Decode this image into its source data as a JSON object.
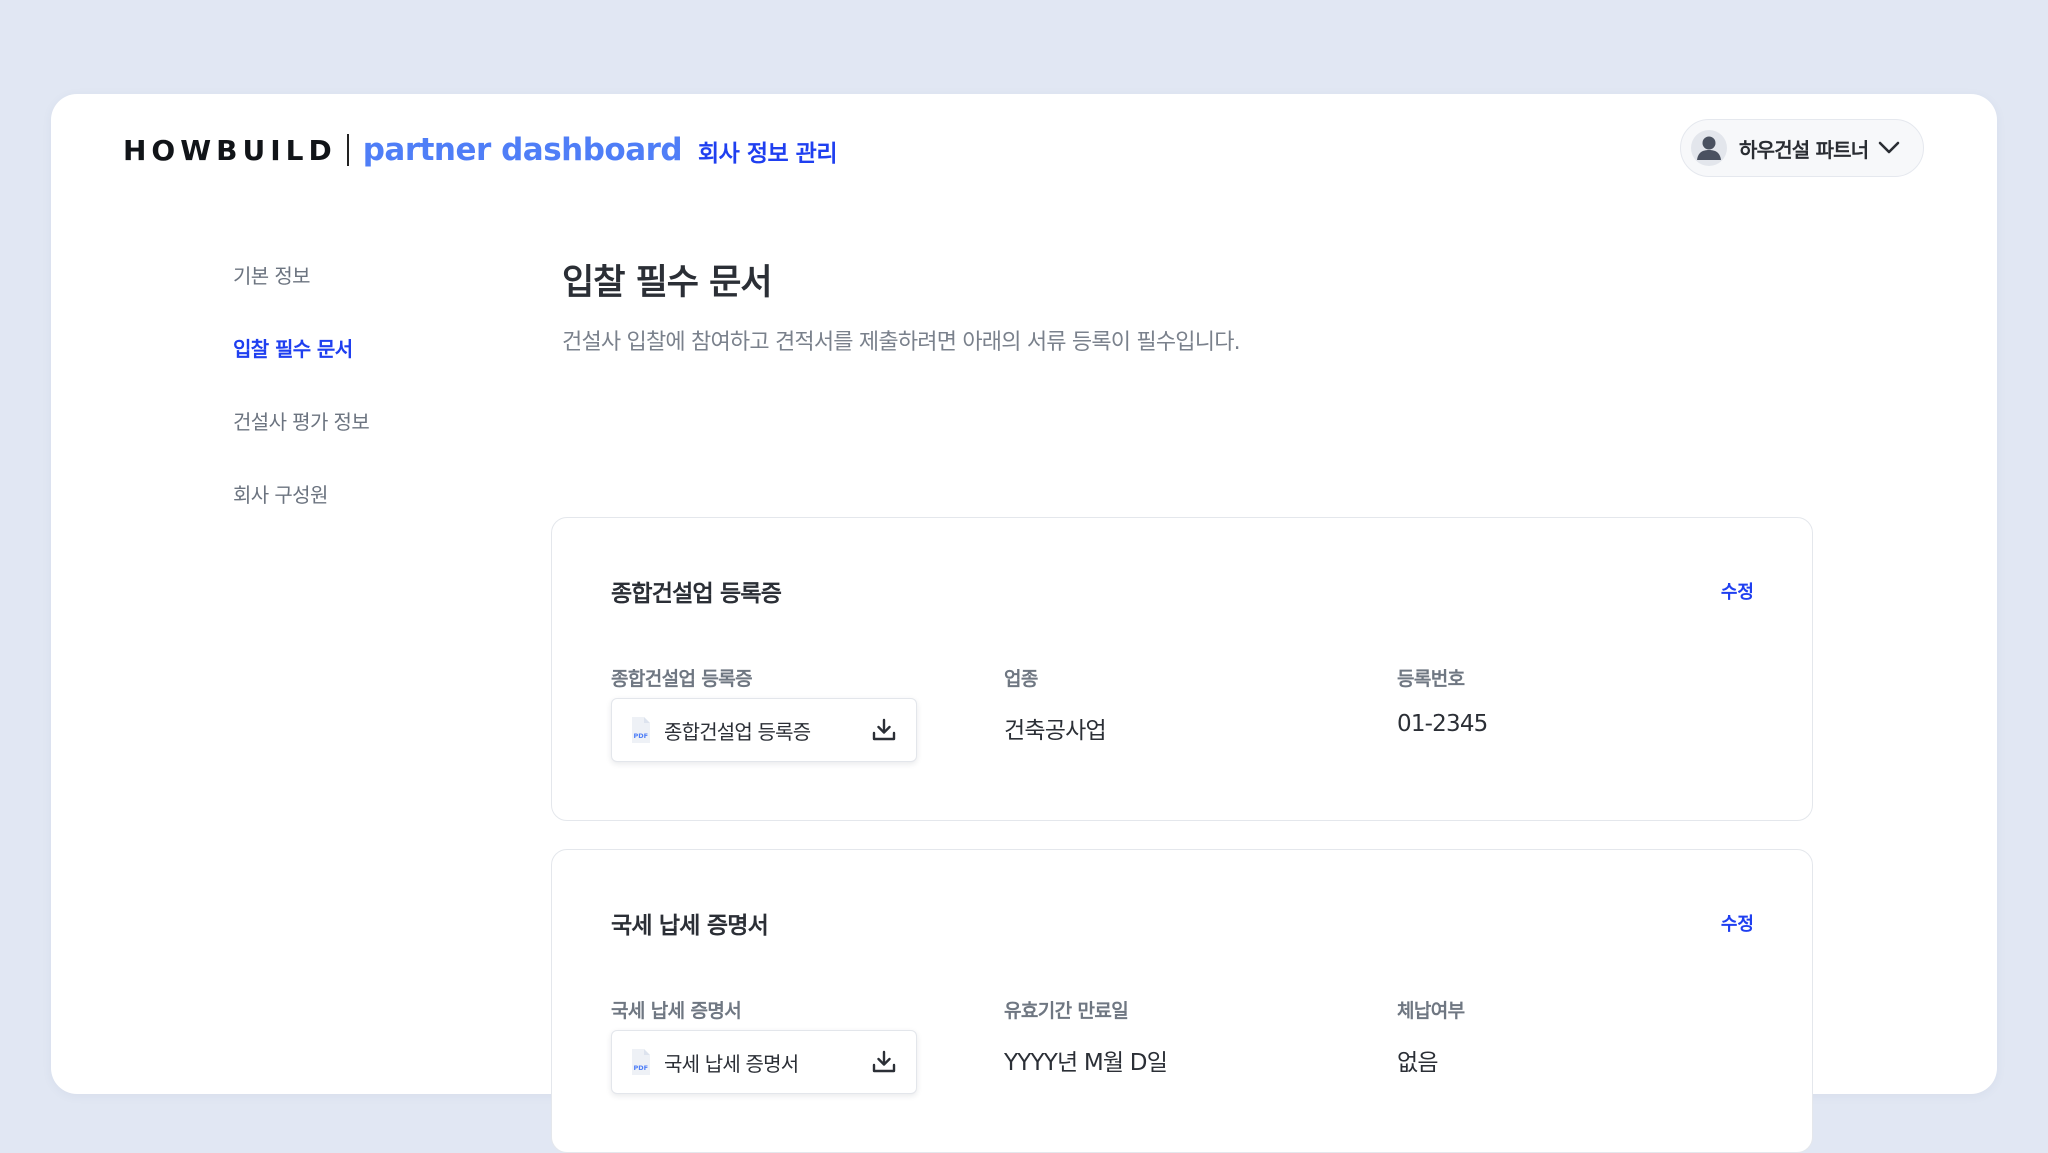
{
  "header": {
    "brand_main": "HOWBUILD",
    "brand_sub": "partner dashboard",
    "nav_label": "회사 정보 관리",
    "user_name": "하우건설 파트너"
  },
  "sidebar": {
    "items": [
      {
        "label": "기본 정보",
        "active": false
      },
      {
        "label": "입찰 필수 문서",
        "active": true
      },
      {
        "label": "건설사 평가 정보",
        "active": false
      },
      {
        "label": "회사 구성원",
        "active": false
      }
    ]
  },
  "main": {
    "title": "입찰 필수 문서",
    "description": "건설사 입찰에 참여하고 견적서를 제출하려면 아래의 서류 등록이 필수입니다.",
    "cards": [
      {
        "title": "종합건설업 등록증",
        "edit_label": "수정",
        "fields": [
          {
            "label": "종합건설업 등록증",
            "file_name": "종합건설업 등록증",
            "file_type": "PDF"
          },
          {
            "label": "업종",
            "value": "건축공사업"
          },
          {
            "label": "등록번호",
            "value": "01-2345"
          }
        ]
      },
      {
        "title": "국세 납세 증명서",
        "edit_label": "수정",
        "fields": [
          {
            "label": "국세 납세 증명서",
            "file_name": "국세 납세 증명서",
            "file_type": "PDF"
          },
          {
            "label": "유효기간 만료일",
            "value": "YYYY년 M월 D일"
          },
          {
            "label": "체납여부",
            "value": "없음"
          }
        ]
      }
    ]
  },
  "colors": {
    "background": "#e1e7f3",
    "accent": "#1f3ff0",
    "brand_blue": "#4f7ef7",
    "text_primary": "#2b2f36",
    "text_muted": "#7a818c"
  },
  "icons": {
    "avatar": "user-avatar-icon",
    "chevron": "chevron-down-icon",
    "file": "pdf-file-icon",
    "download": "download-icon"
  }
}
